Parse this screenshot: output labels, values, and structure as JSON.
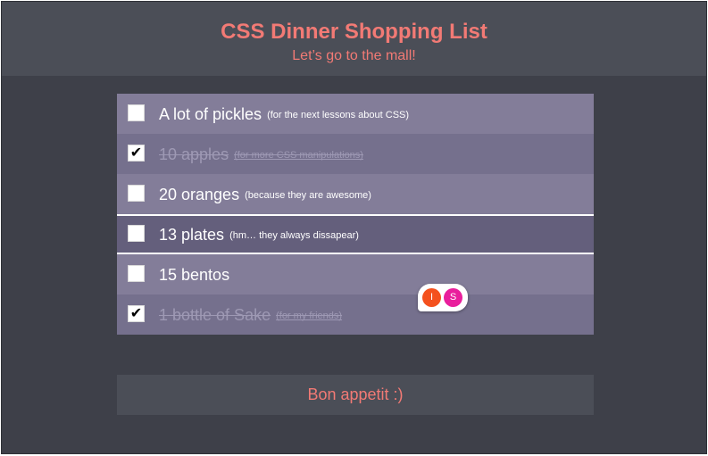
{
  "header": {
    "title": "CSS Dinner Shopping List",
    "subtitle": "Let’s go to the mall!"
  },
  "items": [
    {
      "name": "A lot of pickles",
      "note": "(for the next lessons about CSS)",
      "checked": false
    },
    {
      "name": "10 apples",
      "note": "(for more CSS manipulations)",
      "checked": true
    },
    {
      "name": "20 oranges",
      "note": "(because they are awesome)",
      "checked": false
    },
    {
      "name": "13 plates",
      "note": "(hm… they always dissapear)",
      "checked": false
    },
    {
      "name": "15 bentos",
      "note": "",
      "checked": false
    },
    {
      "name": "1 bottle of Sake",
      "note": "(for my friends)",
      "checked": true
    }
  ],
  "checkmark": "✔",
  "collaborators": [
    {
      "initial": "I",
      "color": "#f4511e"
    },
    {
      "initial": "S",
      "color": "#e91e9c"
    }
  ],
  "footer": {
    "text": "Bon appetit :)"
  },
  "colors": {
    "accent": "#f27a75",
    "list_background": "#837d99",
    "checked_row": "#75708d",
    "highlight_row": "#645f7c",
    "page_background": "#3e4049",
    "header_background": "#4b4e57"
  }
}
